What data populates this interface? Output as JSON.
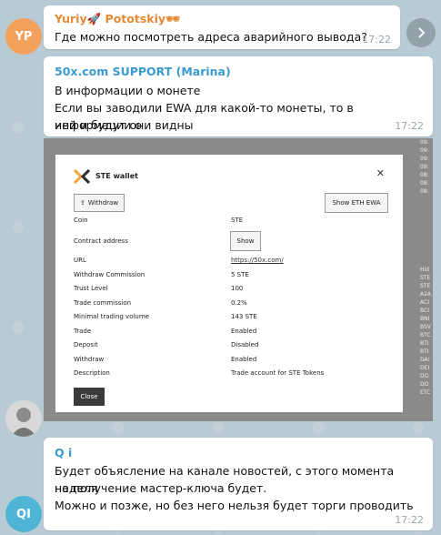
{
  "messages": [
    {
      "avatar_initials": "YP",
      "avatar_color": "#f4a15d",
      "sender": "Yuriy🚀 Pototskiy🕶",
      "sender_color": "#e58a34",
      "text": "Где можно посмотреть адреса аварийного вывода?",
      "time": "17:22"
    },
    {
      "sender": "50x.com SUPPORT (Marina)",
      "sender_color": "#3a9bd1",
      "text_line1": "В информации о монете",
      "text_line2": "Если вы заводили EWA для какой-то монеты, то в информации о",
      "text_line3": "ней и будут они видны",
      "time": "17:22"
    },
    {
      "avatar_initials": "QI",
      "avatar_color": "#4fb5d6",
      "sender": "Q i",
      "sender_color": "#3a9bd1",
      "text_line1": "Будет объясление на канале новостей, с этого момента неделя",
      "text_line2": "на получение мастер-ключа будет.",
      "text_line3": "Можно и позже, но без него нельзя будет торги проводить",
      "time": "17:22"
    }
  ],
  "wallet": {
    "title": "STE wallet",
    "withdraw_button": "Withdraw",
    "show_ewa_button": "Show ETH EWA",
    "show_button": "Show",
    "close_button": "Close",
    "rows": [
      {
        "key": "Coin",
        "value": "STE"
      },
      {
        "key": "Contract address",
        "value": ""
      },
      {
        "key": "URL",
        "value": "https://50x.com/"
      },
      {
        "key": "Withdraw Commission",
        "value": "5 STE"
      },
      {
        "key": "Trust Level",
        "value": "100"
      },
      {
        "key": "Trade commission",
        "value": "0.2%"
      },
      {
        "key": "Minimal trading volume",
        "value": "143 STE"
      },
      {
        "key": "Trade",
        "value": "Enabled"
      },
      {
        "key": "Deposit",
        "value": "Disabled"
      },
      {
        "key": "Withdraw",
        "value": "Enabled"
      },
      {
        "key": "Description",
        "value": "Trade account for STE Tokens"
      }
    ],
    "side_strip": [
      "09:",
      "09:",
      "09:",
      "09:",
      "08:",
      "08:",
      "08:",
      "09:",
      "09:",
      "",
      "",
      "",
      "Hid",
      "STE",
      "STE",
      "A2A",
      "ACI",
      "BCI",
      "BNI",
      "BSV",
      "BTC",
      "BTI",
      "BTI",
      "DA!",
      "DEI",
      "DG",
      "DO",
      "ETC"
    ]
  }
}
